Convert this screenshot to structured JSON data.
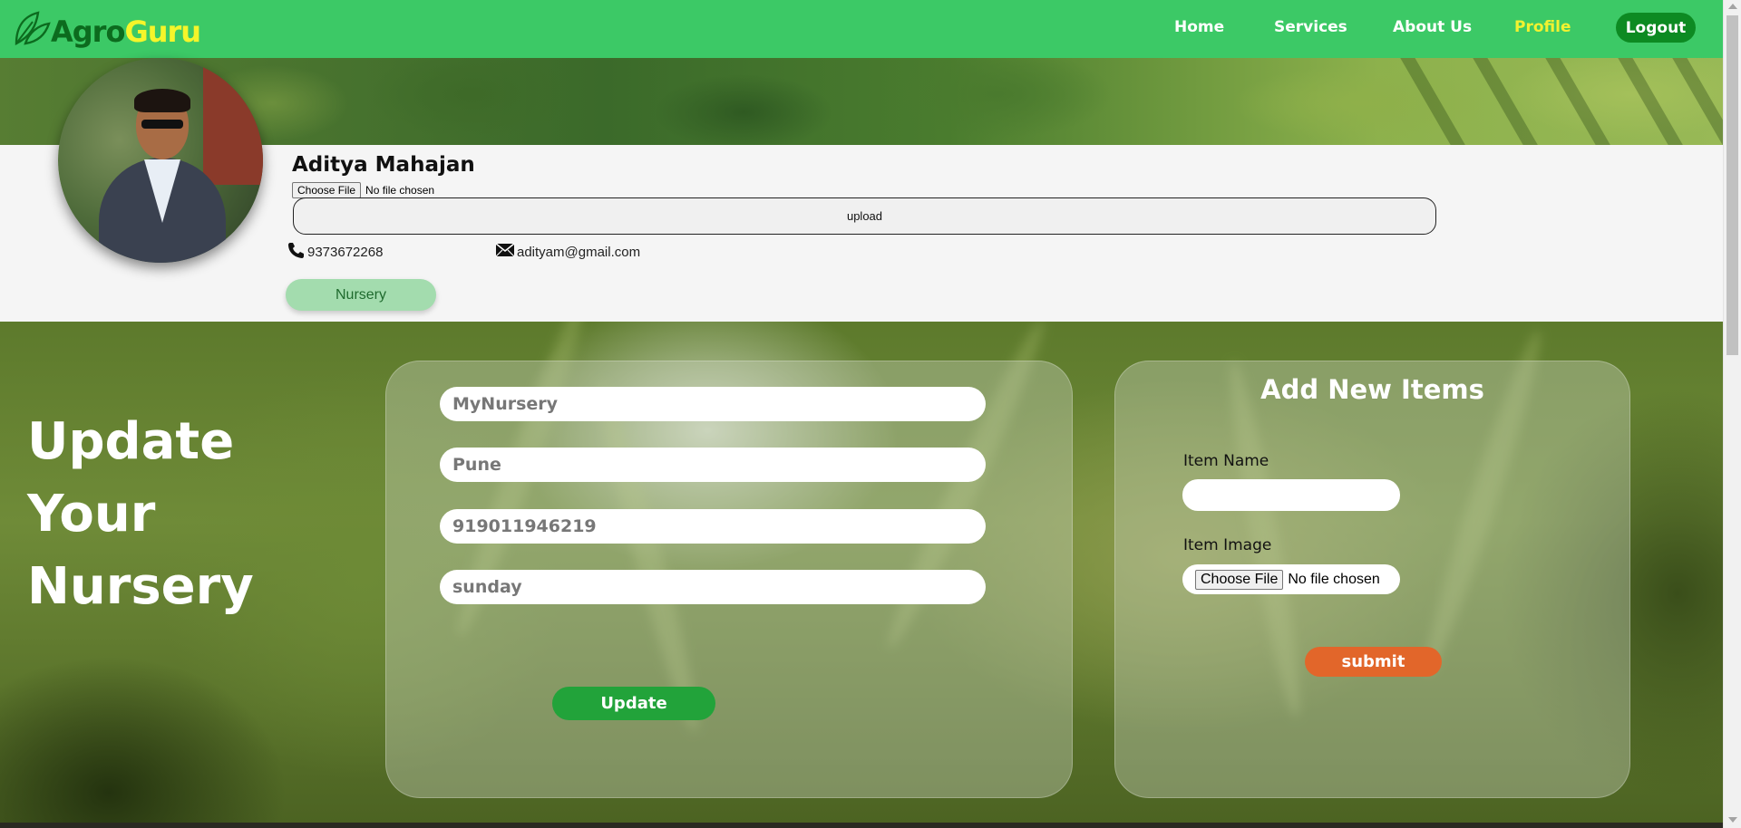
{
  "navbar": {
    "logo_part1": "Agro",
    "logo_part2": "Guru",
    "logo_icon": "leaf-icon",
    "links": [
      "Home",
      "Services",
      "About Us",
      "Profile"
    ],
    "active_link": "Profile",
    "logout_label": "Logout"
  },
  "profile": {
    "name": "Aditya Mahajan",
    "file_button": "Choose File",
    "file_status": "No file chosen",
    "upload_label": "upload",
    "phone_icon": "phone-icon",
    "phone": "9373672268",
    "email_icon": "mail-icon",
    "email": "adityam@gmail.com",
    "role": "Nursery"
  },
  "update_section": {
    "heading_lines": [
      "Update",
      "Your",
      "Nursery"
    ],
    "fields": [
      {
        "value": "MyNursery"
      },
      {
        "value": "Pune"
      },
      {
        "value": "919011946219"
      },
      {
        "value": "sunday"
      }
    ],
    "update_label": "Update"
  },
  "add_items": {
    "title": "Add New Items",
    "item_name_label": "Item Name",
    "item_name_value": "",
    "item_image_label": "Item Image",
    "file_button": "Choose File",
    "file_status": "No file chosen",
    "submit_label": "submit"
  },
  "colors": {
    "navbar": "#3cc966",
    "logo_dark": "#0c6b1e",
    "logo_accent": "#f5f52a",
    "active_link": "#f2f230",
    "logout": "#0d8a22",
    "update_button": "#22a33a",
    "submit_button": "#e2662a",
    "role_pill": "#a3dcae"
  }
}
